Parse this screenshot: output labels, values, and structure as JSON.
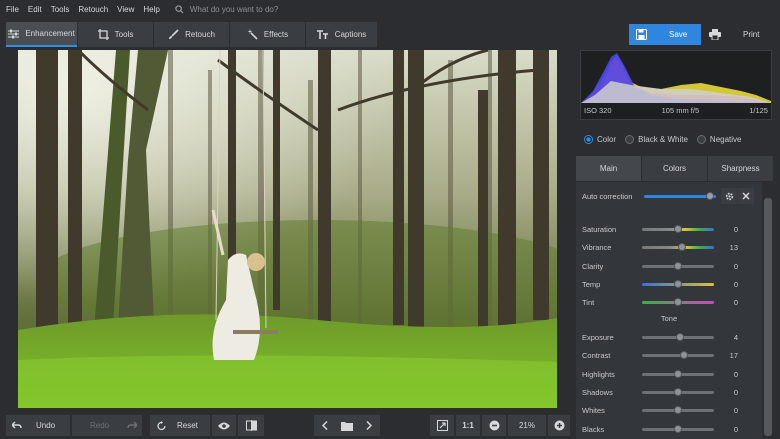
{
  "menu": [
    "File",
    "Edit",
    "Tools",
    "Retouch",
    "View",
    "Help"
  ],
  "search": {
    "placeholder": "What do you want to do?"
  },
  "toolbar": {
    "tabs": [
      {
        "label": "Enhancement",
        "icon": "sliders-icon",
        "active": true
      },
      {
        "label": "Tools",
        "icon": "crop-icon"
      },
      {
        "label": "Retouch",
        "icon": "brush-icon"
      },
      {
        "label": "Effects",
        "icon": "magic-wand-icon"
      },
      {
        "label": "Captions",
        "icon": "text-icon"
      }
    ],
    "save_label": "Save",
    "print_label": "Print"
  },
  "histogram": {
    "iso": "ISO 320",
    "lens": "105 mm f/5",
    "shutter": "1/125"
  },
  "color_modes": {
    "options": [
      "Color",
      "Black & White",
      "Negative"
    ],
    "selected": "Color"
  },
  "panel_tabs": [
    "Main",
    "Colors",
    "Sharpness"
  ],
  "auto_correction": {
    "label": "Auto correction"
  },
  "adjustments": [
    {
      "label": "Saturation",
      "value": "0"
    },
    {
      "label": "Vibrance",
      "value": "13"
    },
    {
      "label": "Clarity",
      "value": "0"
    },
    {
      "label": "Temp",
      "value": "0"
    },
    {
      "label": "Tint",
      "value": "0"
    }
  ],
  "tone_heading": "Tone",
  "tone": [
    {
      "label": "Exposure",
      "value": "4"
    },
    {
      "label": "Contrast",
      "value": "17"
    },
    {
      "label": "Highlights",
      "value": "0"
    },
    {
      "label": "Shadows",
      "value": "0"
    },
    {
      "label": "Whites",
      "value": "0"
    },
    {
      "label": "Blacks",
      "value": "0"
    }
  ],
  "bottom": {
    "undo_label": "Undo",
    "redo_label": "Redo",
    "reset_label": "Reset",
    "ratio_label": "1:1",
    "zoom": "21%"
  },
  "colors": {
    "accent": "#2e86de",
    "panel": "#2b2d30",
    "button": "#3a3d41"
  }
}
